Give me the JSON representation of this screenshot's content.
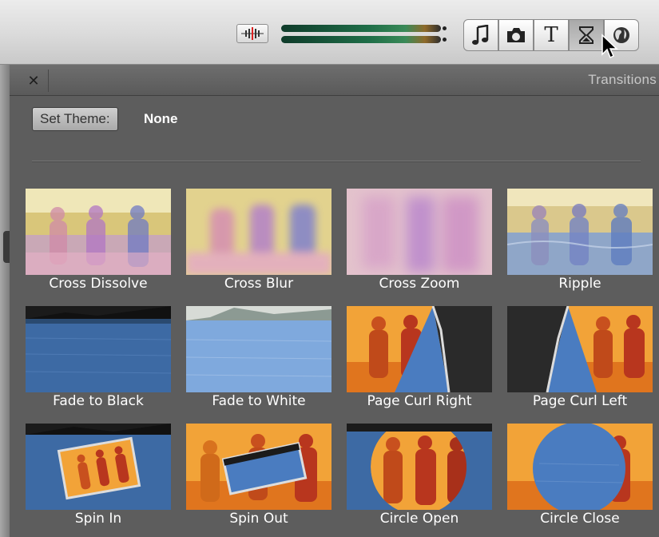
{
  "toolbar": {
    "buttons": [
      {
        "icon": "music-note-icon"
      },
      {
        "icon": "camera-icon"
      },
      {
        "icon": "title-text-icon",
        "glyph": "T"
      },
      {
        "icon": "hourglass-transitions-icon",
        "active": true
      },
      {
        "icon": "globe-icon"
      }
    ]
  },
  "panel": {
    "title": "Transitions",
    "close_glyph": "✕",
    "set_theme_label": "Set Theme:",
    "theme_value": "None"
  },
  "transitions": [
    {
      "name": "Cross Dissolve"
    },
    {
      "name": "Cross Blur"
    },
    {
      "name": "Cross Zoom"
    },
    {
      "name": "Ripple"
    },
    {
      "name": "Fade to Black"
    },
    {
      "name": "Fade to White"
    },
    {
      "name": "Page Curl Right"
    },
    {
      "name": "Page Curl Left"
    },
    {
      "name": "Spin In"
    },
    {
      "name": "Spin Out"
    },
    {
      "name": "Circle Open"
    },
    {
      "name": "Circle Close"
    }
  ],
  "colors": {
    "panel_bg": "#5d5d5d",
    "sky_orange": "#f2a338",
    "water_blue": "#3f73b8",
    "rider_red": "#b8361e"
  }
}
